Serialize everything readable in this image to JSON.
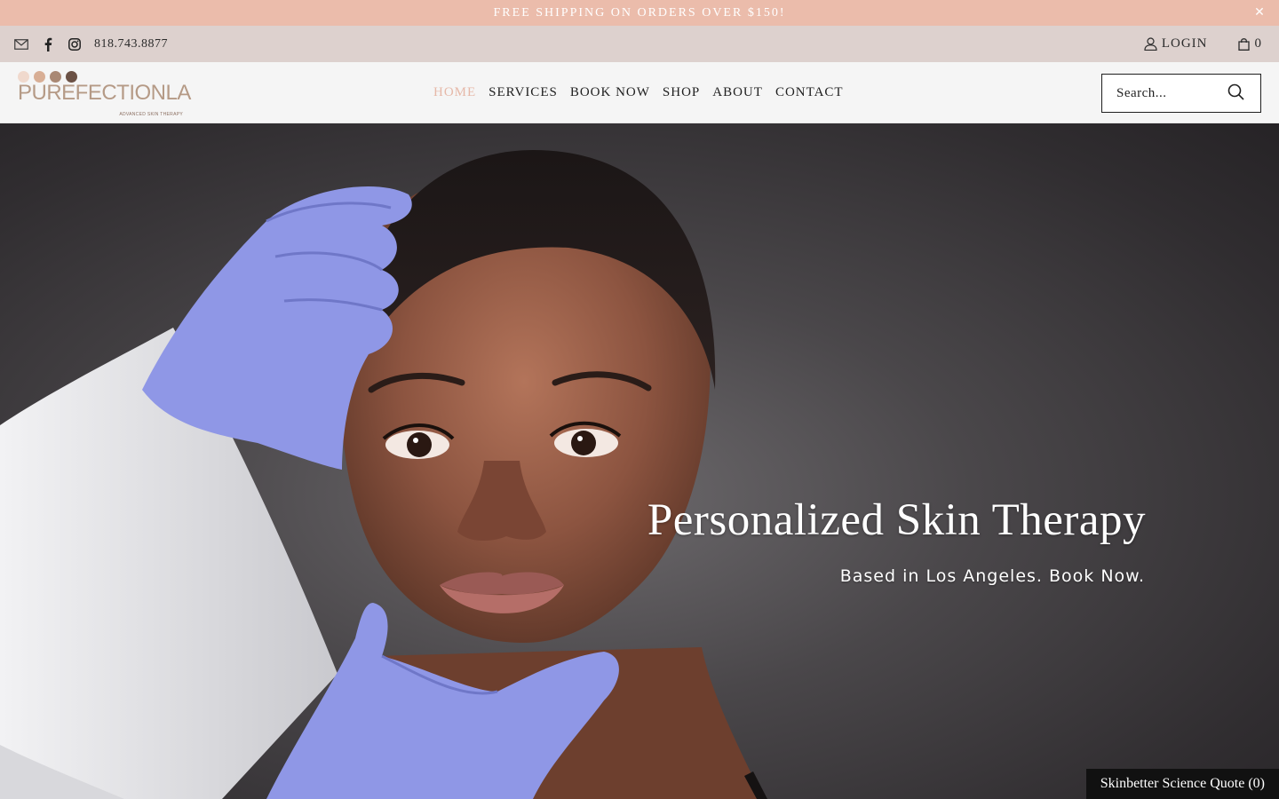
{
  "announcement": {
    "text": "FREE SHIPPING ON ORDERS OVER $150!",
    "close_icon": "close-icon"
  },
  "utility": {
    "icons": [
      "mail-icon",
      "facebook-icon",
      "instagram-icon"
    ],
    "phone": "818.743.8877",
    "login_label": "LOGIN",
    "cart_count": "0"
  },
  "header": {
    "logo": {
      "wordmark": "PUREFECTIONLA",
      "tagline": "ADVANCED SKIN THERAPY",
      "dot_colors": [
        "#f0d9cd",
        "#d8ae95",
        "#a98874",
        "#6b5145"
      ]
    },
    "nav": [
      {
        "label": "HOME",
        "active": true
      },
      {
        "label": "SERVICES",
        "active": false
      },
      {
        "label": "BOOK NOW",
        "active": false
      },
      {
        "label": "SHOP",
        "active": false
      },
      {
        "label": "ABOUT",
        "active": false
      },
      {
        "label": "CONTACT",
        "active": false
      }
    ],
    "search": {
      "placeholder": "Search..."
    }
  },
  "hero": {
    "title": "Personalized Skin Therapy",
    "subtitle": "Based in Los Angeles. Book Now."
  },
  "quote_button": {
    "label": "Skinbetter Science Quote (0)"
  },
  "colors": {
    "announcement_bg": "#ebbcab",
    "utility_bg": "#ddd1ce",
    "header_bg": "#f5f5f5",
    "nav_active": "#e6b8a8",
    "glove": "#8f97e6"
  }
}
